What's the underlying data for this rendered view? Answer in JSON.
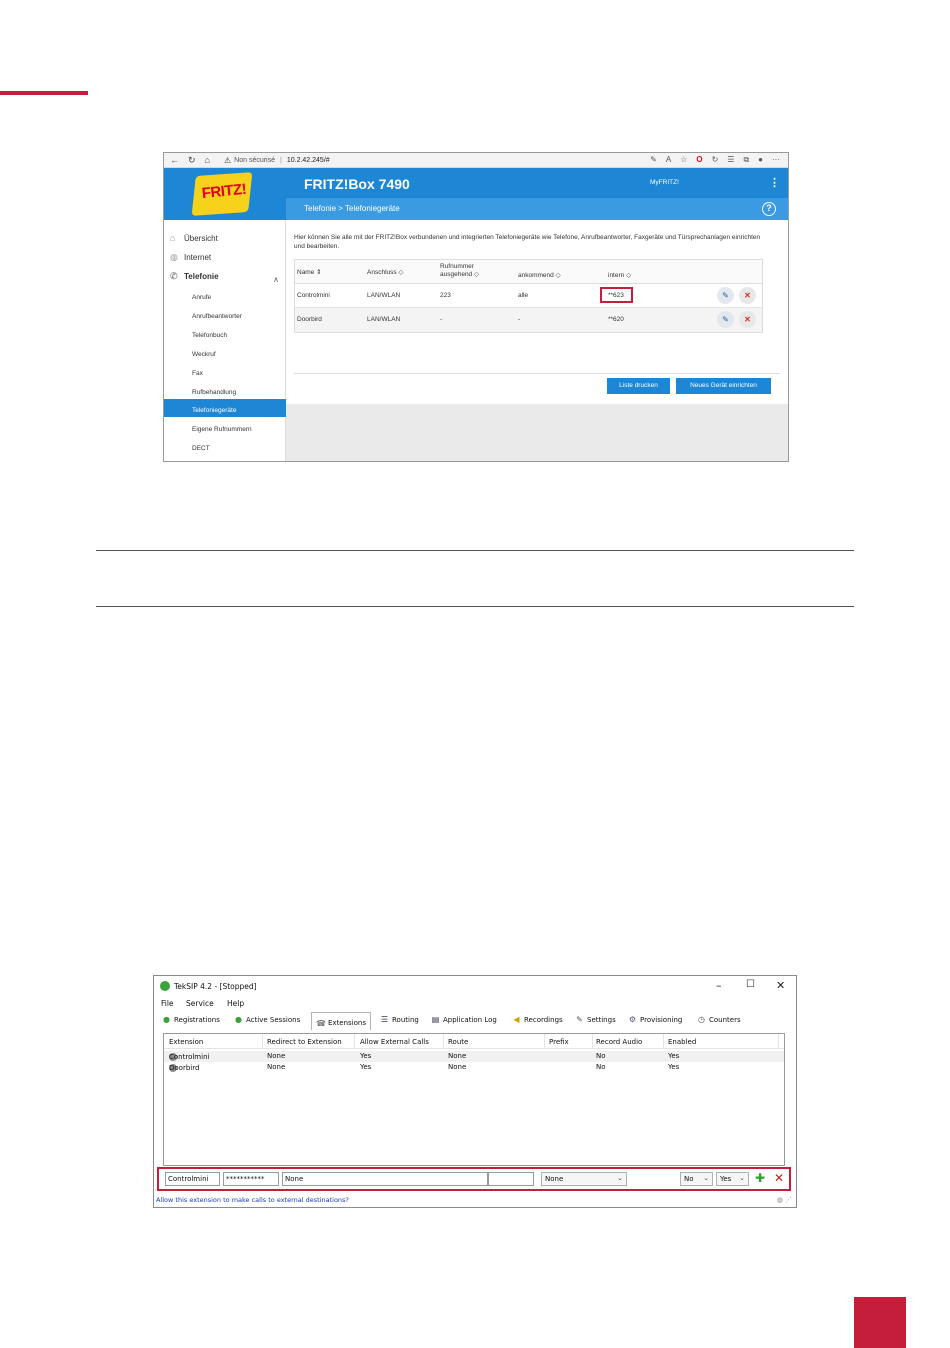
{
  "browser": {
    "security_label": "Non sécurisé",
    "url": "10.2.42.245/#"
  },
  "fritz": {
    "logo_text": "FRITZ!",
    "product_title": "FRITZ!Box 7490",
    "myfritz_label": "MyFRITZ!",
    "breadcrumb": "Telefonie > Telefoniegeräte",
    "help_label": "?",
    "sidebar": {
      "items": [
        {
          "label": "Übersicht",
          "icon": "home-icon"
        },
        {
          "label": "Internet",
          "icon": "globe-icon"
        },
        {
          "label": "Telefonie",
          "icon": "phone-icon"
        }
      ],
      "subitems": [
        "Anrufe",
        "Anrufbeantworter",
        "Telefonbuch",
        "Weckruf",
        "Fax",
        "Rufbehandlung",
        "Telefoniegeräte",
        "Eigene Rufnummern",
        "DECT"
      ],
      "active": "Telefoniegeräte"
    },
    "intro_text": "Hier können Sie alle mit der FRITZ!Box verbundenen und integrierten Telefoniegeräte wie Telefone, Anrufbeantworter, Faxgeräte und Türsprechanlagen einrichten und bearbeiten.",
    "table": {
      "headers": {
        "name": "Name",
        "anschluss": "Anschluss",
        "rufnummer_1": "Rufnummer",
        "rufnummer_2": "ausgehend",
        "ankommend": "ankommend",
        "intern": "intern"
      },
      "rows": [
        {
          "name": "Controlmini",
          "anschluss": "LAN/WLAN",
          "ausgehend": "223",
          "ankommend": "alle",
          "intern": "**623"
        },
        {
          "name": "Doorbird",
          "anschluss": "LAN/WLAN",
          "ausgehend": "-",
          "ankommend": "-",
          "intern": "**620"
        }
      ]
    },
    "buttons": {
      "print": "Liste drucken",
      "new_device": "Neues Gerät einrichten"
    }
  },
  "teksip": {
    "window_title": "TekSIP 4.2 - [Stopped]",
    "window_buttons": {
      "minimize": "–",
      "maximize": "☐",
      "close": "✕"
    },
    "menu": [
      "File",
      "Service",
      "Help"
    ],
    "tabs": [
      "Registrations",
      "Active Sessions",
      "Extensions",
      "Routing",
      "Application Log",
      "Recordings",
      "Settings",
      "Provisioning",
      "Counters"
    ],
    "active_tab": "Extensions",
    "columns": [
      "Extension",
      "Redirect to Extension",
      "Allow External Calls",
      "Route",
      "Prefix",
      "Record Audio",
      "Enabled"
    ],
    "rows": [
      {
        "extension": "Controlmini",
        "redirect": "None",
        "external": "Yes",
        "route": "None",
        "prefix": "",
        "record": "No",
        "enabled": "Yes"
      },
      {
        "extension": "Doorbird",
        "redirect": "None",
        "external": "Yes",
        "route": "None",
        "prefix": "",
        "record": "No",
        "enabled": "Yes"
      }
    ],
    "editor": {
      "extension": "Controlmini",
      "password": "***********",
      "redirect": "None",
      "route": "None",
      "record": "No",
      "enabled": "Yes",
      "add_label": "✚",
      "delete_label": "✕"
    },
    "status_text": "Allow this extension to make calls to external destinations?"
  }
}
